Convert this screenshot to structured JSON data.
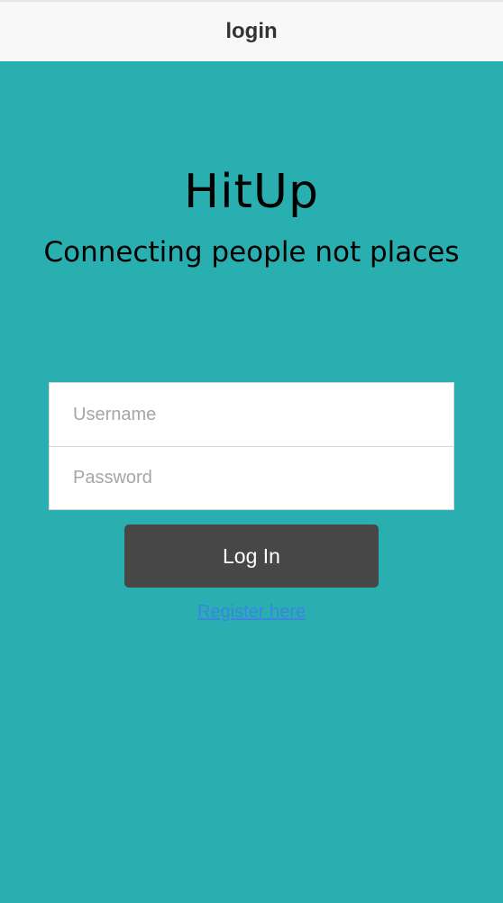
{
  "header": {
    "title": "login"
  },
  "main": {
    "app_title": "HitUp",
    "tagline": "Connecting people not places",
    "form": {
      "username_placeholder": "Username",
      "username_value": "",
      "password_placeholder": "Password",
      "password_value": ""
    },
    "login_label": "Log In",
    "register_label": "Register here"
  },
  "colors": {
    "background": "#29afaf",
    "nav_background": "#f8f8f8",
    "button_background": "#474747",
    "link": "#3d83e2"
  }
}
